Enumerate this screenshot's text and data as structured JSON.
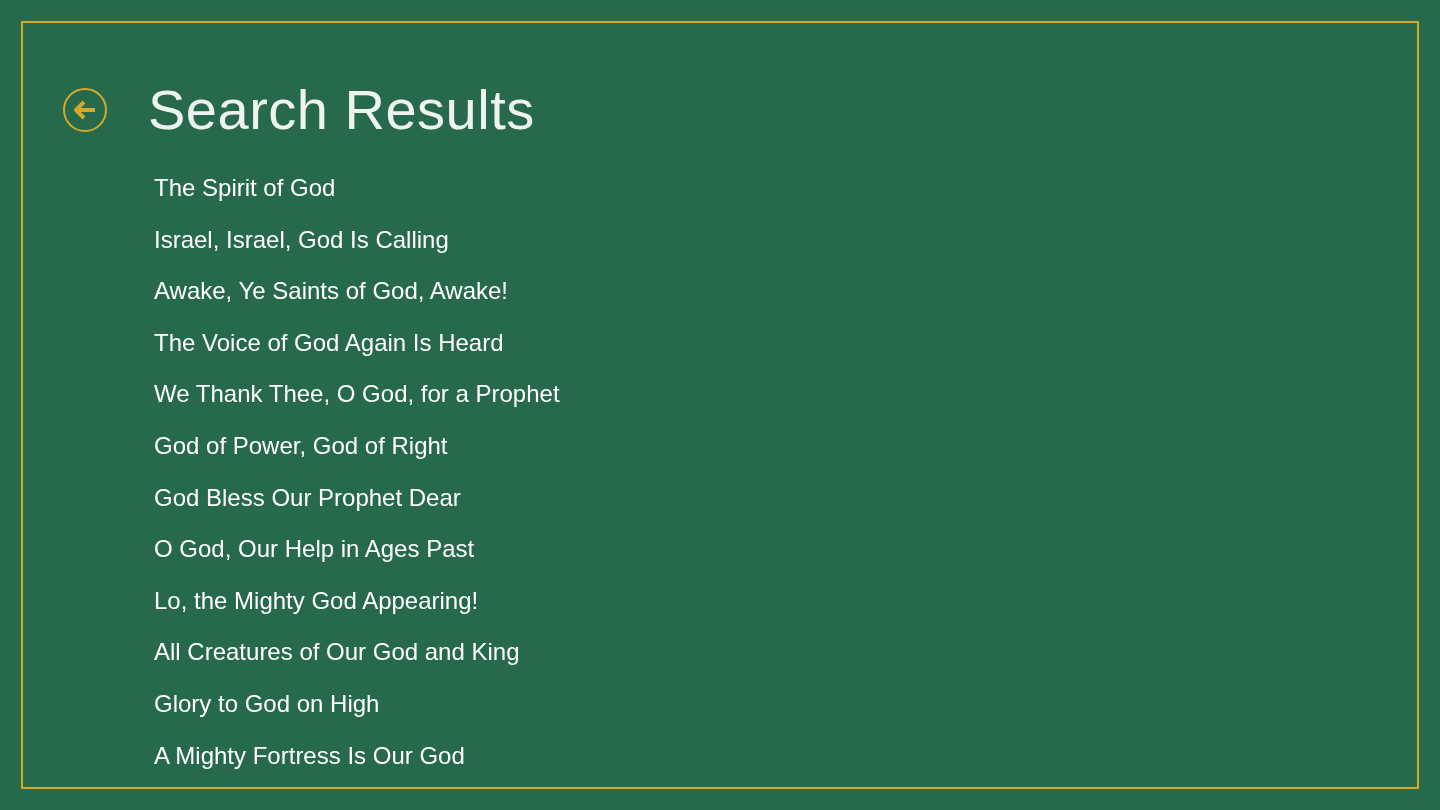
{
  "header": {
    "title": "Search Results"
  },
  "results": [
    {
      "title": "The Spirit of God"
    },
    {
      "title": "Israel, Israel, God Is Calling"
    },
    {
      "title": "Awake, Ye Saints of God, Awake!"
    },
    {
      "title": "The Voice of God Again Is Heard"
    },
    {
      "title": "We Thank Thee, O God, for a Prophet"
    },
    {
      "title": "God of Power, God of Right"
    },
    {
      "title": "God Bless Our Prophet Dear"
    },
    {
      "title": "O God, Our Help in Ages Past"
    },
    {
      "title": "Lo, the Mighty God Appearing!"
    },
    {
      "title": "All Creatures of Our God and King"
    },
    {
      "title": "Glory to God on High"
    },
    {
      "title": "A Mighty Fortress Is Our God"
    }
  ]
}
